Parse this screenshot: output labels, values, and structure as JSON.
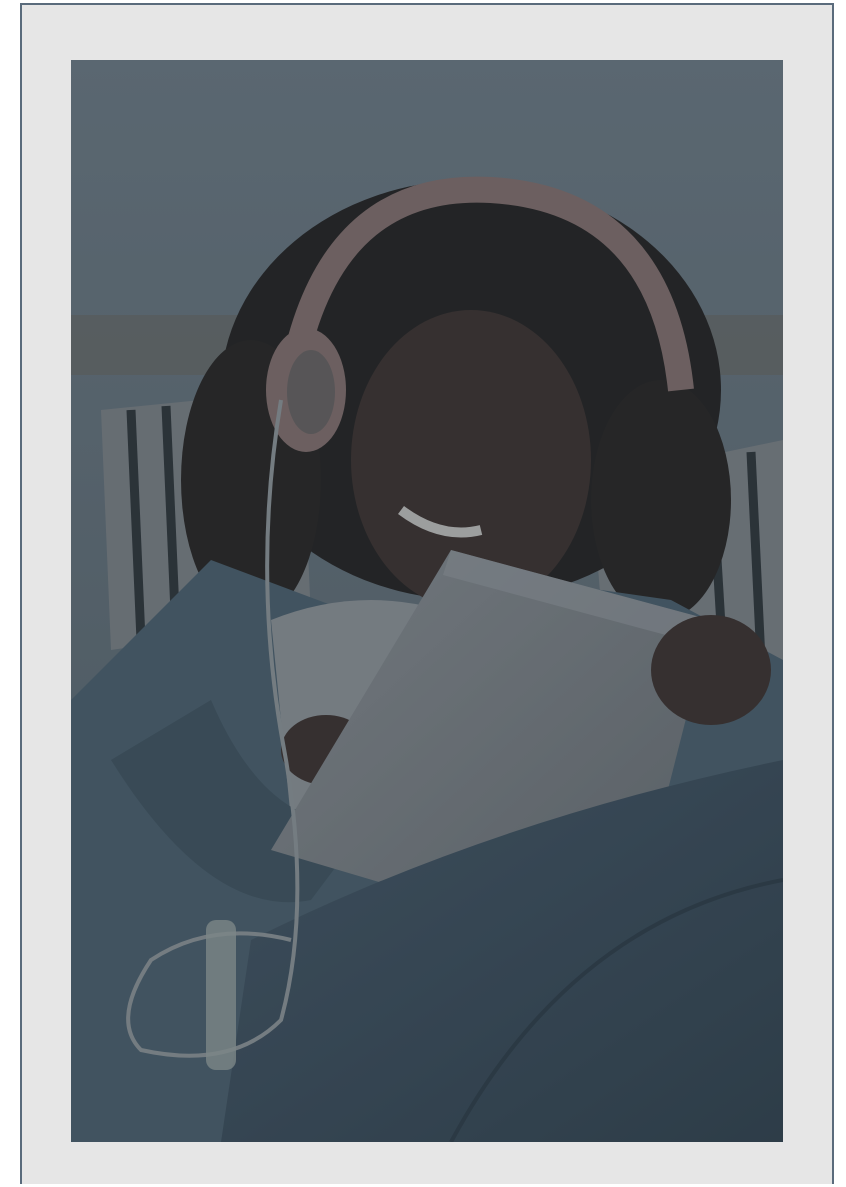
{
  "photo": {
    "alt": "",
    "overlay_color": "#2f3a42",
    "palette": {
      "wall": "#6f7c86",
      "pillow": "#8b8f93",
      "stripe": "#2a3034",
      "skin": "#3b2c27",
      "hair": "#1e1a18",
      "headphones": "#8e7470",
      "jacket": "#4c6270",
      "shirt": "#9a9ea2",
      "tablet": "#8a8e92",
      "jeans": "#3a4f5e",
      "cable": "#9aa0a4"
    }
  }
}
